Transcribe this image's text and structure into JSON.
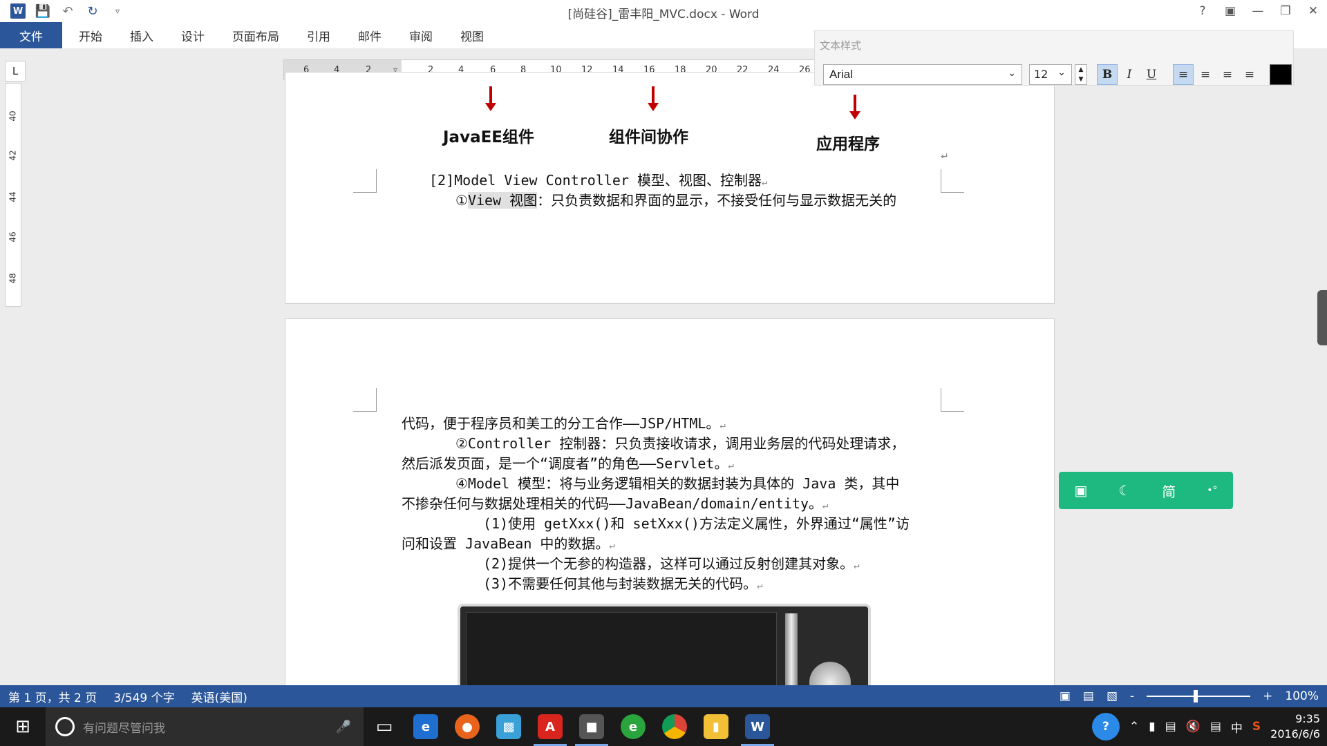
{
  "titlebar": {
    "title": "[尚硅谷]_雷丰阳_MVC.docx - Word",
    "qa_icons": [
      "word-logo",
      "save-icon",
      "undo-icon",
      "redo-icon",
      "customize-icon"
    ],
    "win_buttons": [
      "help-icon",
      "ribbon-display-icon",
      "minimize-icon",
      "restore-icon",
      "close-icon"
    ]
  },
  "ribbon": {
    "tabs": [
      {
        "label": "文件"
      },
      {
        "label": "开始"
      },
      {
        "label": "插入"
      },
      {
        "label": "设计"
      },
      {
        "label": "页面布局"
      },
      {
        "label": "引用"
      },
      {
        "label": "邮件"
      },
      {
        "label": "审阅"
      },
      {
        "label": "视图"
      }
    ]
  },
  "ruler": {
    "corner": "L",
    "h_ticks": [
      "6",
      "4",
      "2",
      "2",
      "4",
      "6",
      "8",
      "10",
      "12",
      "14",
      "16",
      "18",
      "20",
      "22",
      "24",
      "26"
    ],
    "v_ticks": [
      "40",
      "42",
      "44",
      "46",
      "48"
    ]
  },
  "diagram": {
    "label1": "JavaEE组件",
    "label2": "组件间协作",
    "label3": "应用程序"
  },
  "page1": {
    "line1": "[2]Model View Controller 模型、视图、控制器",
    "line2_prefix": "①",
    "line2_hl": "View 视图",
    "line2_rest": "：只负责数据和界面的显示，不接受任何与显示数据无关的"
  },
  "page2": {
    "lines": [
      "代码，便于程序员和美工的分工合作——JSP/HTML。",
      "②Controller 控制器：只负责接收请求，调用业务层的代码处理请求，",
      "然后派发页面，是一个“调度者”的角色——Servlet。",
      "④Model 模型：将与业务逻辑相关的数据封装为具体的 Java 类，其中",
      "不掺杂任何与数据处理相关的代码——JavaBean/domain/entity。",
      "(1)使用 getXxx()和 setXxx()方法定义属性，外界通过“属性”访",
      "问和设置 JavaBean 中的数据。",
      "(2)提供一个无参的构造器，这样可以通过反射创建其对象。",
      "(3)不需要任何其他与封装数据无关的代码。"
    ],
    "para_mark": "↵"
  },
  "style_panel": {
    "title": "文本样式",
    "font": "Arial",
    "size": "12",
    "bold": "B",
    "italic": "I",
    "underline": "U",
    "color": "#000000"
  },
  "green_toolbar": {
    "icons": [
      "book-icon",
      "moon-icon",
      "simplified-icon",
      "more-icon"
    ],
    "simplified_label": "简"
  },
  "statusbar": {
    "page": "第 1 页，共 2 页",
    "words": "3/549 个字",
    "lang": "英语(美国)",
    "zoom": "100%",
    "zoom_minus": "-",
    "zoom_plus": "+"
  },
  "taskbar": {
    "search_placeholder": "有问题尽管问我",
    "ime": "中",
    "time": "9:35",
    "date": "2016/6/6",
    "apps": [
      "edge",
      "firefox",
      "remote-desktop",
      "adobe",
      "java-app",
      "360-browser",
      "chrome",
      "file-explorer",
      "word"
    ]
  },
  "colors": {
    "accent": "#2b579a",
    "arrow": "#c00000",
    "green_toolbar": "#1eb980"
  }
}
